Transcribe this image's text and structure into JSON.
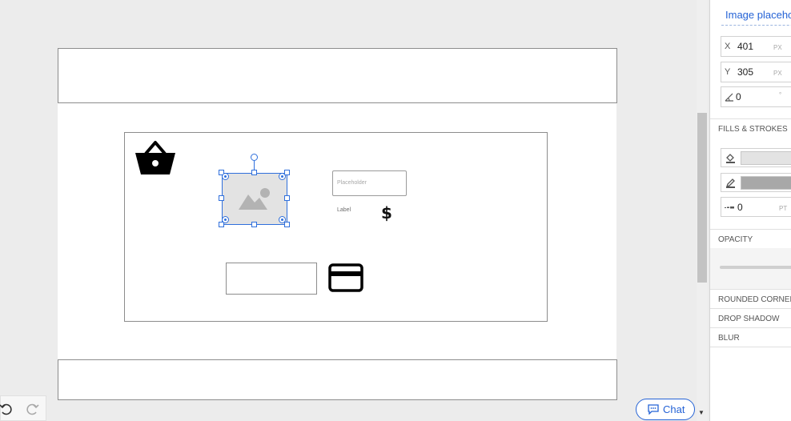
{
  "canvas": {
    "image_placeholder": {
      "icon": "image-icon"
    },
    "text_input": {
      "placeholder": "Placeholder"
    },
    "label": "Label",
    "icons": {
      "basket": "shopping-basket-icon",
      "dollar": "$",
      "card": "credit-card-icon"
    }
  },
  "properties_panel": {
    "element_name": "Image placeholder",
    "x": {
      "prefix": "X",
      "value": "401",
      "unit": "PX"
    },
    "y": {
      "prefix": "Y",
      "value": "305",
      "unit": "PX"
    },
    "rotation": {
      "value": "0",
      "unit": "°"
    },
    "fills_strokes": {
      "title": "FILLS & STROKES",
      "fill_color": "#e3e3e3",
      "stroke_color": "#a8a8a8",
      "stroke_width": {
        "value": "0",
        "unit": "PT"
      }
    },
    "opacity_title": "OPACITY",
    "rounded_corners_title": "ROUNDED CORNERS",
    "drop_shadow_title": "DROP SHADOW",
    "blur_title": "BLUR"
  },
  "bottom": {
    "chat_label": "Chat",
    "undo_icon": "undo-icon",
    "redo_icon": "redo-icon"
  },
  "colors": {
    "accent": "#2563d6",
    "selection": "#2f6fdc"
  }
}
